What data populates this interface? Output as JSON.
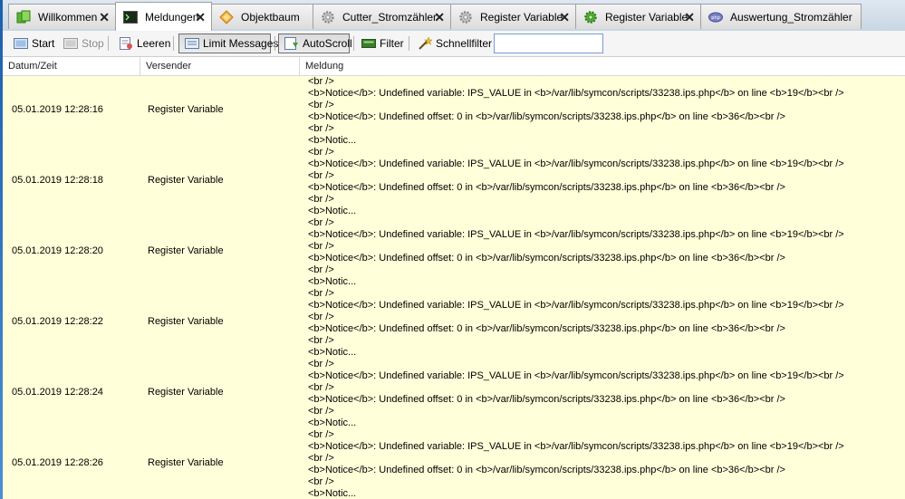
{
  "tabs": [
    {
      "label": "Willkommen",
      "icon": "welcome-icon",
      "closable": true
    },
    {
      "label": "Meldungen",
      "icon": "console-icon",
      "closable": true,
      "active": true
    },
    {
      "label": "Objektbaum",
      "icon": "object-tree-icon",
      "closable": false
    },
    {
      "label": "Cutter_Stromzähler",
      "icon": "gear-icon",
      "closable": true
    },
    {
      "label": "Register Variable",
      "icon": "gear-icon",
      "closable": true
    },
    {
      "label": "Register Variable",
      "icon": "gear-green-icon",
      "closable": true
    },
    {
      "label": "Auswertung_Stromzähler",
      "icon": "php-icon",
      "closable": false
    }
  ],
  "toolbar": {
    "start_label": "Start",
    "stop_label": "Stop",
    "clear_label": "Leeren",
    "limit_label": "Limit Messages",
    "autoscroll_label": "AutoScroll",
    "filter_label": "Filter",
    "quickfilter_label": "Schnellfilter",
    "quickfilter_value": ""
  },
  "columns": {
    "datetime": "Datum/Zeit",
    "sender": "Versender",
    "message": "Meldung"
  },
  "colors": {
    "row_background": "#ffffd9",
    "pressed_button": "#dcdcdc",
    "frame_blue": "#1d5fa8"
  },
  "rows": [
    {
      "datetime": "05.01.2019 12:28:16",
      "sender": "Register Variable",
      "lines": [
        "<br />",
        "<b>Notice</b>:  Undefined variable: IPS_VALUE in <b>/var/lib/symcon/scripts/33238.ips.php</b> on line <b>19</b><br />",
        "<br />",
        "<b>Notice</b>:  Undefined offset: 0 in <b>/var/lib/symcon/scripts/33238.ips.php</b> on line <b>36</b><br />",
        "<br />",
        "<b>Notic..."
      ]
    },
    {
      "datetime": "05.01.2019 12:28:18",
      "sender": "Register Variable",
      "lines": [
        "<br />",
        "<b>Notice</b>:  Undefined variable: IPS_VALUE in <b>/var/lib/symcon/scripts/33238.ips.php</b> on line <b>19</b><br />",
        "<br />",
        "<b>Notice</b>:  Undefined offset: 0 in <b>/var/lib/symcon/scripts/33238.ips.php</b> on line <b>36</b><br />",
        "<br />",
        "<b>Notic..."
      ]
    },
    {
      "datetime": "05.01.2019 12:28:20",
      "sender": "Register Variable",
      "lines": [
        "<br />",
        "<b>Notice</b>:  Undefined variable: IPS_VALUE in <b>/var/lib/symcon/scripts/33238.ips.php</b> on line <b>19</b><br />",
        "<br />",
        "<b>Notice</b>:  Undefined offset: 0 in <b>/var/lib/symcon/scripts/33238.ips.php</b> on line <b>36</b><br />",
        "<br />",
        "<b>Notic..."
      ]
    },
    {
      "datetime": "05.01.2019 12:28:22",
      "sender": "Register Variable",
      "lines": [
        "<br />",
        "<b>Notice</b>:  Undefined variable: IPS_VALUE in <b>/var/lib/symcon/scripts/33238.ips.php</b> on line <b>19</b><br />",
        "<br />",
        "<b>Notice</b>:  Undefined offset: 0 in <b>/var/lib/symcon/scripts/33238.ips.php</b> on line <b>36</b><br />",
        "<br />",
        "<b>Notic..."
      ]
    },
    {
      "datetime": "05.01.2019 12:28:24",
      "sender": "Register Variable",
      "lines": [
        "<br />",
        "<b>Notice</b>:  Undefined variable: IPS_VALUE in <b>/var/lib/symcon/scripts/33238.ips.php</b> on line <b>19</b><br />",
        "<br />",
        "<b>Notice</b>:  Undefined offset: 0 in <b>/var/lib/symcon/scripts/33238.ips.php</b> on line <b>36</b><br />",
        "<br />",
        "<b>Notic..."
      ]
    },
    {
      "datetime": "05.01.2019 12:28:26",
      "sender": "Register Variable",
      "lines": [
        "<br />",
        "<b>Notice</b>:  Undefined variable: IPS_VALUE in <b>/var/lib/symcon/scripts/33238.ips.php</b> on line <b>19</b><br />",
        "<br />",
        "<b>Notice</b>:  Undefined offset: 0 in <b>/var/lib/symcon/scripts/33238.ips.php</b> on line <b>36</b><br />",
        "<br />",
        "<b>Notic..."
      ]
    }
  ]
}
